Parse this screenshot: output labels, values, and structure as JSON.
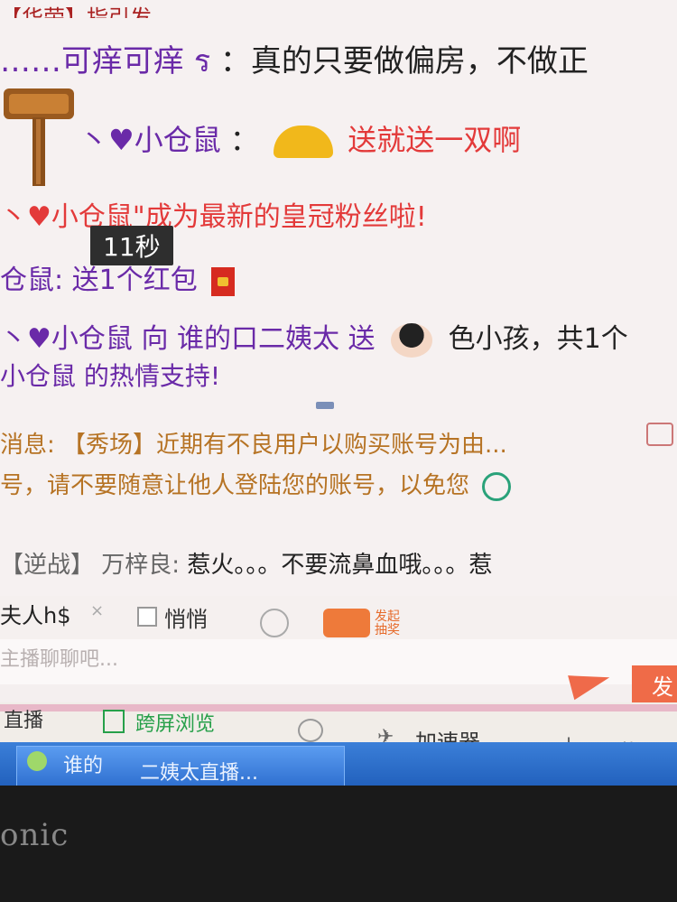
{
  "chat": {
    "line1_partial": "【华荣】指引发",
    "line2": {
      "user": "……可痒可痒",
      "icon": "ร",
      "sep": "：",
      "text": "真的只要做偏房，不做正"
    },
    "line3": {
      "user": "丶♥小仓鼠",
      "sep": "：",
      "text": "送就送一双啊"
    },
    "line4": {
      "text": "丶♥小仓鼠\"成为最新的皇冠粉丝啦",
      "mark": "!"
    },
    "timer": "11秒",
    "line5": {
      "prefix": "仓鼠:",
      "text": "送1个红包"
    },
    "line6": {
      "user": "丶♥小仓鼠",
      "verb": "向",
      "target": "谁的口二姨太",
      "send": "送",
      "gift": "色小孩，共1个"
    },
    "line7": {
      "user": "小仓鼠",
      "text": "的热情支持!"
    },
    "line8": {
      "label": "消息:",
      "text": "【秀场】近期有不良用户以购买账号为由..."
    },
    "line9": {
      "text": "号，请不要随意让他人登陆您的账号，以免您"
    },
    "line10": {
      "tag": "【逆战】",
      "user": "万梓良:",
      "text": "惹火。。。不要流鼻血哦。。。惹"
    }
  },
  "input": {
    "nickname": "夫人h$",
    "close_mark": "×",
    "whisper_label": "悄悄",
    "lottery_label": "发起抽奖",
    "placeholder": "主播聊聊吧...",
    "send_label": "发"
  },
  "nav": {
    "live": "直播",
    "cross_screen": "跨屏浏览",
    "accelerator": "加速器",
    "download": "下载"
  },
  "taskbar": {
    "title_a": "谁的",
    "title_b": "二姨太直播..."
  },
  "monitor_brand": "onic",
  "colors": {
    "accent": "#ef6b48",
    "username": "#6a2aa8",
    "system_red": "#e33a3a"
  }
}
